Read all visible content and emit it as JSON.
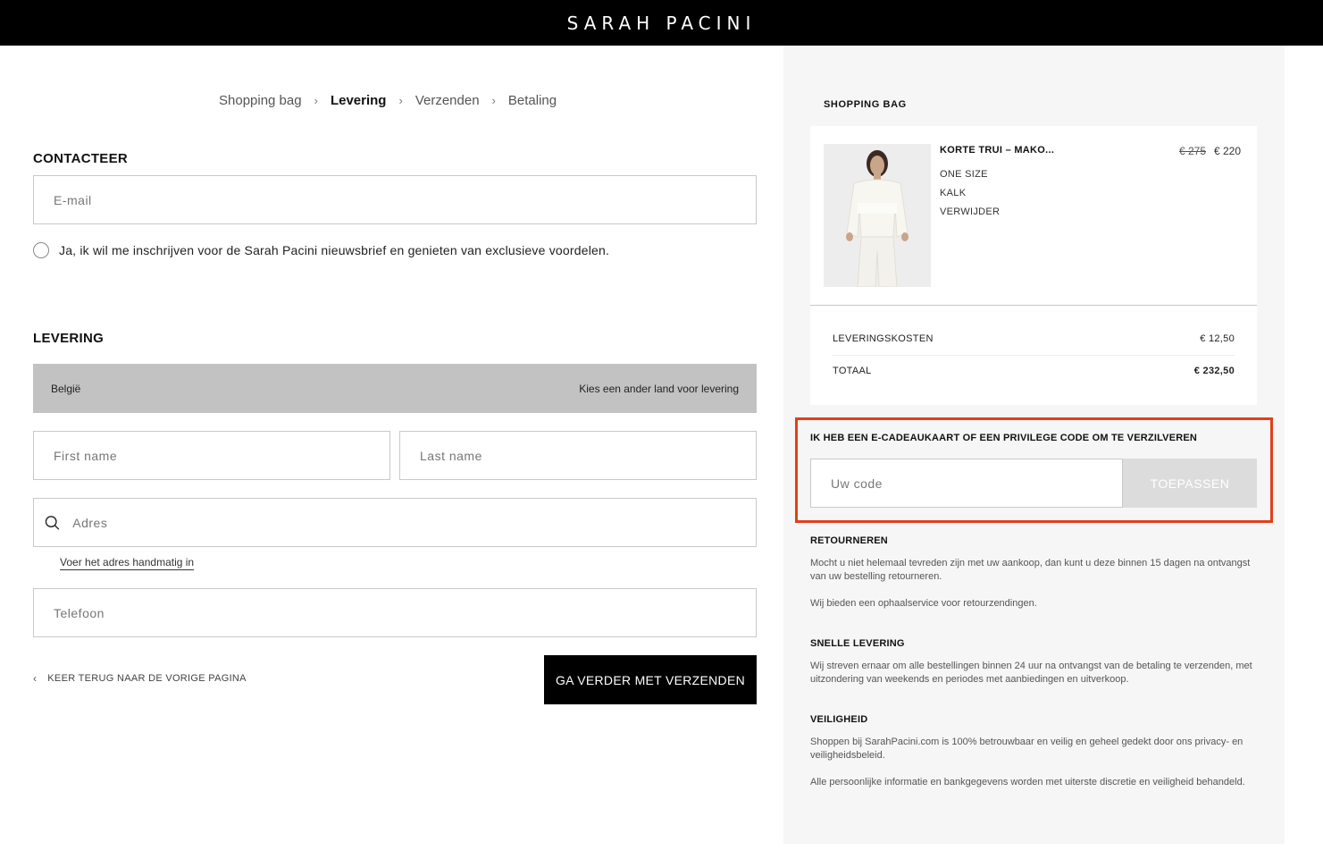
{
  "brand": "SARAH PACINI",
  "breadcrumb": [
    {
      "label": "Shopping bag"
    },
    {
      "label": "Levering"
    },
    {
      "label": "Verzenden"
    },
    {
      "label": "Betaling"
    }
  ],
  "breadcrumb_separator": "›",
  "contact": {
    "title": "CONTACTEER",
    "email_placeholder": "E-mail",
    "newsletter_label": "Ja, ik wil me inschrijven voor de Sarah Pacini nieuwsbrief en genieten van exclusieve voordelen."
  },
  "delivery": {
    "title": "LEVERING",
    "country": "België",
    "change_country": "Kies een ander land voor levering",
    "first_name_placeholder": "First name",
    "last_name_placeholder": "Last name",
    "address_placeholder": "Adres",
    "manual_address_link": "Voer het adres handmatig in",
    "phone_placeholder": "Telefoon"
  },
  "actions": {
    "back_label": "KEER TERUG NAAR DE VORIGE PAGINA",
    "back_icon": "chevron-left-icon",
    "continue_label": "GA VERDER MET VERZENDEN"
  },
  "bag": {
    "title": "SHOPPING BAG",
    "item": {
      "name": "KORTE TRUI – MAKO...",
      "price_old": "€ 275",
      "price_new": "€ 220",
      "size": "ONE SIZE",
      "color": "KALK",
      "remove": "VERWIJDER"
    },
    "shipping_label": "LEVERINGSKOSTEN",
    "shipping_value": "€ 12,50",
    "total_label": "TOTAAL",
    "total_value": "€ 232,50"
  },
  "promo": {
    "label": "IK HEB EEN E-CADEAUKAART OF EEN PRIVILEGE CODE OM TE VERZILVEREN",
    "placeholder": "Uw code",
    "button": "TOEPASSEN",
    "highlight_color": "#e0401a"
  },
  "info": [
    {
      "title": "RETOURNEREN",
      "paragraphs": [
        "Mocht u niet helemaal tevreden zijn met uw aankoop, dan kunt u deze binnen 15 dagen na ontvangst van uw bestelling retourneren.",
        "Wij bieden een ophaalservice voor retourzendingen."
      ]
    },
    {
      "title": "SNELLE LEVERING",
      "paragraphs": [
        "Wij streven ernaar om alle bestellingen binnen 24 uur na ontvangst van de betaling te verzenden, met uitzondering van weekends en periodes met aanbiedingen en uitverkoop."
      ]
    },
    {
      "title": "VEILIGHEID",
      "paragraphs": [
        "Shoppen bij SarahPacini.com is 100% betrouwbaar en veilig en geheel gedekt door ons privacy- en veiligheidsbeleid.",
        "Alle persoonlijke informatie en bankgegevens worden met uiterste discretie en veiligheid behandeld."
      ]
    }
  ]
}
